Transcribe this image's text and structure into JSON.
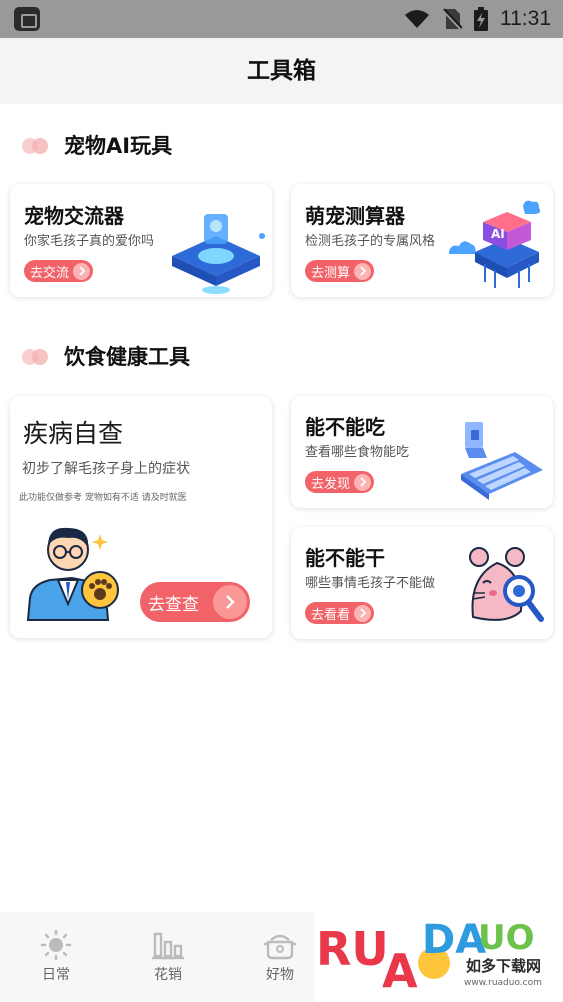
{
  "status_bar": {
    "time": "11:31"
  },
  "nav": {
    "title": "工具箱"
  },
  "sections": [
    {
      "title": "宠物AI玩具"
    },
    {
      "title": "饮食健康工具"
    }
  ],
  "pet_ai_cards": [
    {
      "title": "宠物交流器",
      "subtitle": "你家毛孩子真的爱你吗",
      "button": "去交流"
    },
    {
      "title": "萌宠测算器",
      "subtitle": "检测毛孩子的专属风格",
      "button": "去测算"
    }
  ],
  "disease_card": {
    "title": "疾病自查",
    "subtitle": "初步了解毛孩子身上的症状",
    "disclaimer": "此功能仅做参考 宠物如有不适 请及时就医",
    "button": "去查查"
  },
  "food_cards": [
    {
      "title": "能不能吃",
      "subtitle": "查看哪些食物能吃",
      "button": "去发现"
    },
    {
      "title": "能不能干",
      "subtitle": "哪些事情毛孩子不能做",
      "button": "去看看"
    }
  ],
  "tabs": [
    {
      "label": "日常",
      "icon": "sun-icon"
    },
    {
      "label": "花销",
      "icon": "bar-chart-icon"
    },
    {
      "label": "好物",
      "icon": "pot-icon"
    }
  ],
  "watermark": {
    "logo": "RUADUO",
    "cn": "如多下载网",
    "url": "www.ruaduo.com"
  },
  "colors": {
    "accent": "#f16368",
    "accent_light": "#fbb3b3",
    "nav_bg": "#f4f4f4",
    "status_bg": "#999999"
  }
}
